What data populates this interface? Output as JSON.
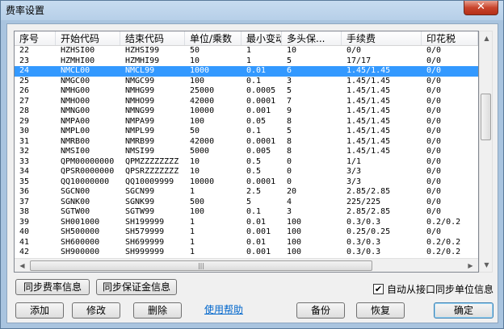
{
  "window": {
    "title": "费率设置",
    "close_glyph": "✕"
  },
  "columns": [
    "序号",
    "开始代码",
    "结束代码",
    "单位/乘数",
    "最小变动",
    "多头保...",
    "手续费",
    "印花税"
  ],
  "rows": [
    [
      "22",
      "HZHSI00",
      "HZHSI99",
      "50",
      "1",
      "10",
      "0/0",
      "0/0"
    ],
    [
      "23",
      "HZMHI00",
      "HZMHI99",
      "10",
      "1",
      "5",
      "17/17",
      "0/0"
    ],
    [
      "24",
      "NMCL00",
      "NMCL99",
      "1000",
      "0.01",
      "6",
      "1.45/1.45",
      "0/0"
    ],
    [
      "25",
      "NMGC00",
      "NMGC99",
      "100",
      "0.1",
      "3",
      "1.45/1.45",
      "0/0"
    ],
    [
      "26",
      "NMHG00",
      "NMHG99",
      "25000",
      "0.0005",
      "5",
      "1.45/1.45",
      "0/0"
    ],
    [
      "27",
      "NMHO00",
      "NMHO99",
      "42000",
      "0.0001",
      "7",
      "1.45/1.45",
      "0/0"
    ],
    [
      "28",
      "NMNG00",
      "NMNG99",
      "10000",
      "0.001",
      "9",
      "1.45/1.45",
      "0/0"
    ],
    [
      "29",
      "NMPA00",
      "NMPA99",
      "100",
      "0.05",
      "8",
      "1.45/1.45",
      "0/0"
    ],
    [
      "30",
      "NMPL00",
      "NMPL99",
      "50",
      "0.1",
      "5",
      "1.45/1.45",
      "0/0"
    ],
    [
      "31",
      "NMRB00",
      "NMRB99",
      "42000",
      "0.0001",
      "8",
      "1.45/1.45",
      "0/0"
    ],
    [
      "32",
      "NMSI00",
      "NMSI99",
      "5000",
      "0.005",
      "8",
      "1.45/1.45",
      "0/0"
    ],
    [
      "33",
      "QPM00000000",
      "QPMZZZZZZZZ",
      "10",
      "0.5",
      "0",
      "1/1",
      "0/0"
    ],
    [
      "34",
      "QPSR0000000",
      "QPSRZZZZZZZ",
      "10",
      "0.5",
      "0",
      "3/3",
      "0/0"
    ],
    [
      "35",
      "QQ10000000",
      "QQ10009999",
      "10000",
      "0.0001",
      "0",
      "3/3",
      "0/0"
    ],
    [
      "36",
      "SGCN00",
      "SGCN99",
      "1",
      "2.5",
      "20",
      "2.85/2.85",
      "0/0"
    ],
    [
      "37",
      "SGNK00",
      "SGNK99",
      "500",
      "5",
      "4",
      "225/225",
      "0/0"
    ],
    [
      "38",
      "SGTW00",
      "SGTW99",
      "100",
      "0.1",
      "3",
      "2.85/2.85",
      "0/0"
    ],
    [
      "39",
      "SH001000",
      "SH199999",
      "1",
      "0.01",
      "100",
      "0.3/0.3",
      "0.2/0.2"
    ],
    [
      "40",
      "SH500000",
      "SH579999",
      "1",
      "0.001",
      "100",
      "0.25/0.25",
      "0/0"
    ],
    [
      "41",
      "SH600000",
      "SH699999",
      "1",
      "0.01",
      "100",
      "0.3/0.3",
      "0.2/0.2"
    ],
    [
      "42",
      "SH900000",
      "SH999999",
      "1",
      "0.001",
      "100",
      "0.3/0.3",
      "0.2/0.2"
    ]
  ],
  "selected_row": "24",
  "buttons": {
    "sync_fee": "同步费率信息",
    "sync_margin": "同步保证金信息",
    "add": "添加",
    "modify": "修改",
    "delete": "删除",
    "backup": "备份",
    "restore": "恢复",
    "ok": "确定"
  },
  "help_link": "使用帮助",
  "auto_sync_checkbox": {
    "label": "自动从接口同步单位信息",
    "checked": true,
    "mark": "✔"
  },
  "scroll": {
    "left_arrow": "◀",
    "right_arrow": "▶",
    "up_arrow": "▲",
    "down_arrow": "▼",
    "grip": "|||"
  }
}
